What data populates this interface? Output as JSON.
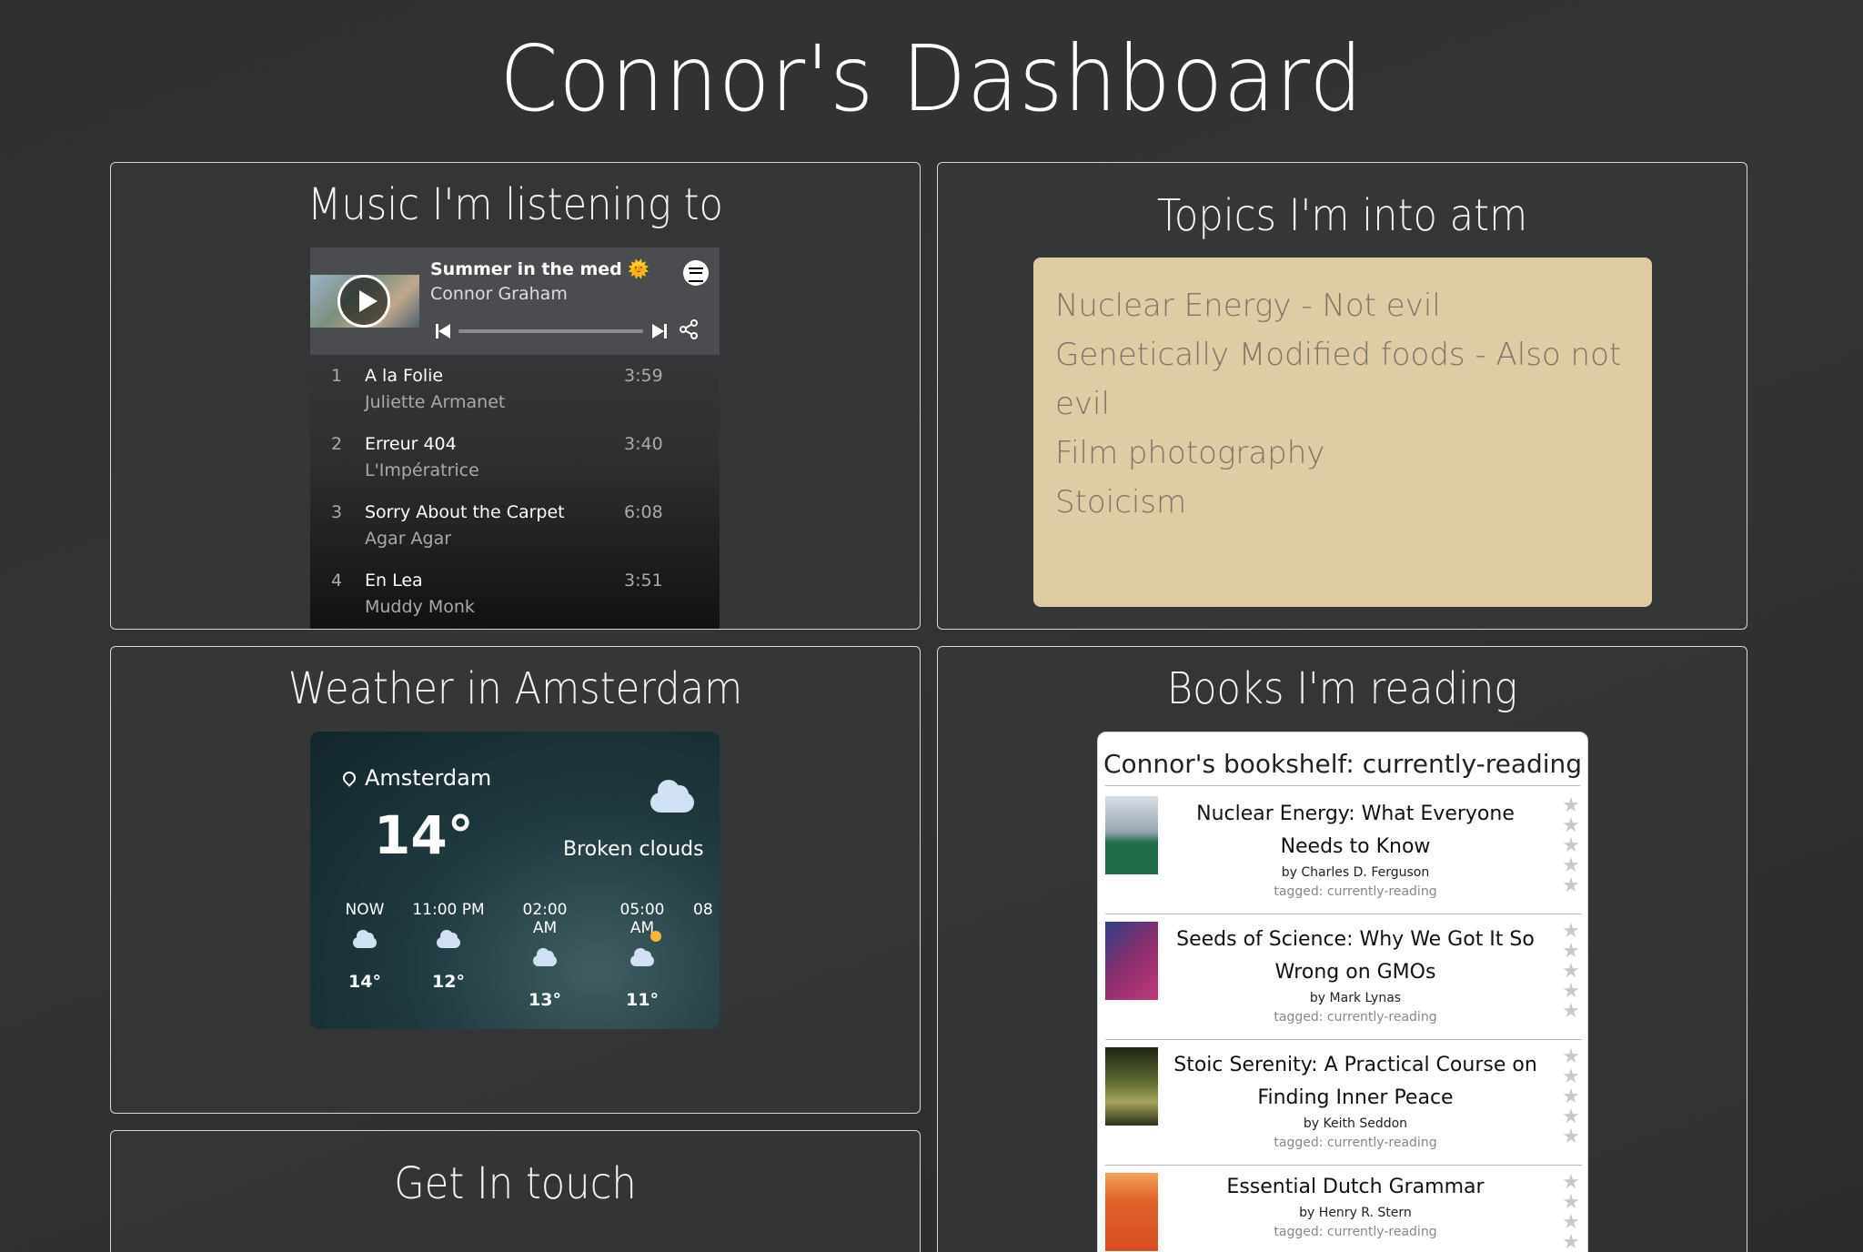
{
  "page": {
    "title": "Connor's Dashboard"
  },
  "music": {
    "title": "Music I'm listening to",
    "player": {
      "song": "Summer in the med 🌞",
      "artist": "Connor Graham",
      "tracks": [
        {
          "num": "1",
          "title": "A la Folie",
          "artist": "Juliette Armanet",
          "duration": "3:59"
        },
        {
          "num": "2",
          "title": "Erreur 404",
          "artist": "L'Impératrice",
          "duration": "3:40"
        },
        {
          "num": "3",
          "title": "Sorry About the Carpet",
          "artist": "Agar Agar",
          "duration": "6:08"
        },
        {
          "num": "4",
          "title": "En Lea",
          "artist": "Muddy Monk",
          "duration": "3:51"
        }
      ]
    }
  },
  "topics": {
    "title": "Topics I'm into atm",
    "items": [
      "Nuclear Energy - Not evil",
      "Genetically Modified foods - Also not evil",
      "Film photography",
      "Stoicism"
    ]
  },
  "weather": {
    "title": "Weather in Amsterdam",
    "city": "Amsterdam",
    "temp": "14°",
    "description": "Broken clouds",
    "hours": [
      {
        "time": "NOW",
        "temp": "14°"
      },
      {
        "time": "11:00 PM",
        "temp": "12°"
      },
      {
        "time": "02:00 AM",
        "temp": "13°"
      },
      {
        "time": "05:00 AM",
        "temp": "11°"
      },
      {
        "time": "08",
        "temp": ""
      }
    ]
  },
  "books": {
    "title": "Books I'm reading",
    "shelf_title": "Connor's bookshelf: currently-reading",
    "items": [
      {
        "title": "Nuclear Energy: What Everyone Needs to Know",
        "author": "by Charles D. Ferguson",
        "tag": "tagged: currently-reading",
        "cover_color": "#5a7d6a"
      },
      {
        "title": "Seeds of Science: Why We Got It So Wrong on GMOs",
        "author": "by Mark Lynas",
        "tag": "tagged: currently-reading",
        "cover_color": "#7a3b6e"
      },
      {
        "title": "Stoic Serenity: A Practical Course on Finding Inner Peace",
        "author": "by Keith Seddon",
        "tag": "tagged: currently-reading",
        "cover_color": "#4d5a2e"
      },
      {
        "title": "Essential Dutch Grammar",
        "author": "by Henry R. Stern",
        "tag": "tagged: currently-reading",
        "cover_color": "#e0622a"
      }
    ]
  },
  "contact": {
    "title": "Get In touch"
  }
}
